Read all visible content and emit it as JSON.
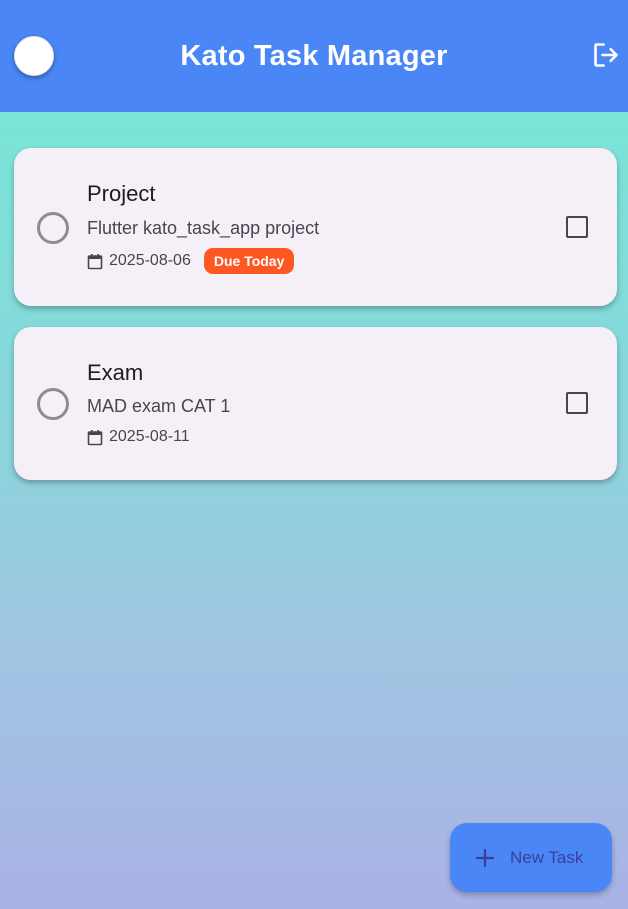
{
  "appbar": {
    "title": "Kato Task Manager",
    "avatar_icon": "user-avatar",
    "logout_icon": "logout-icon",
    "color": "#4a86f6"
  },
  "tasks": [
    {
      "title": "Project",
      "description": "Flutter kato_task_app project",
      "due_date": "2025-08-06",
      "badge": "Due Today",
      "completed": false,
      "checked": false
    },
    {
      "title": "Exam",
      "description": "MAD exam CAT 1",
      "due_date": "2025-08-11",
      "completed": false,
      "checked": false
    }
  ],
  "fab": {
    "label": "New Task",
    "icon": "plus-icon"
  },
  "colors": {
    "badge": "#ff5722",
    "card": "#f5f0f8",
    "accent": "#4a86f6"
  }
}
